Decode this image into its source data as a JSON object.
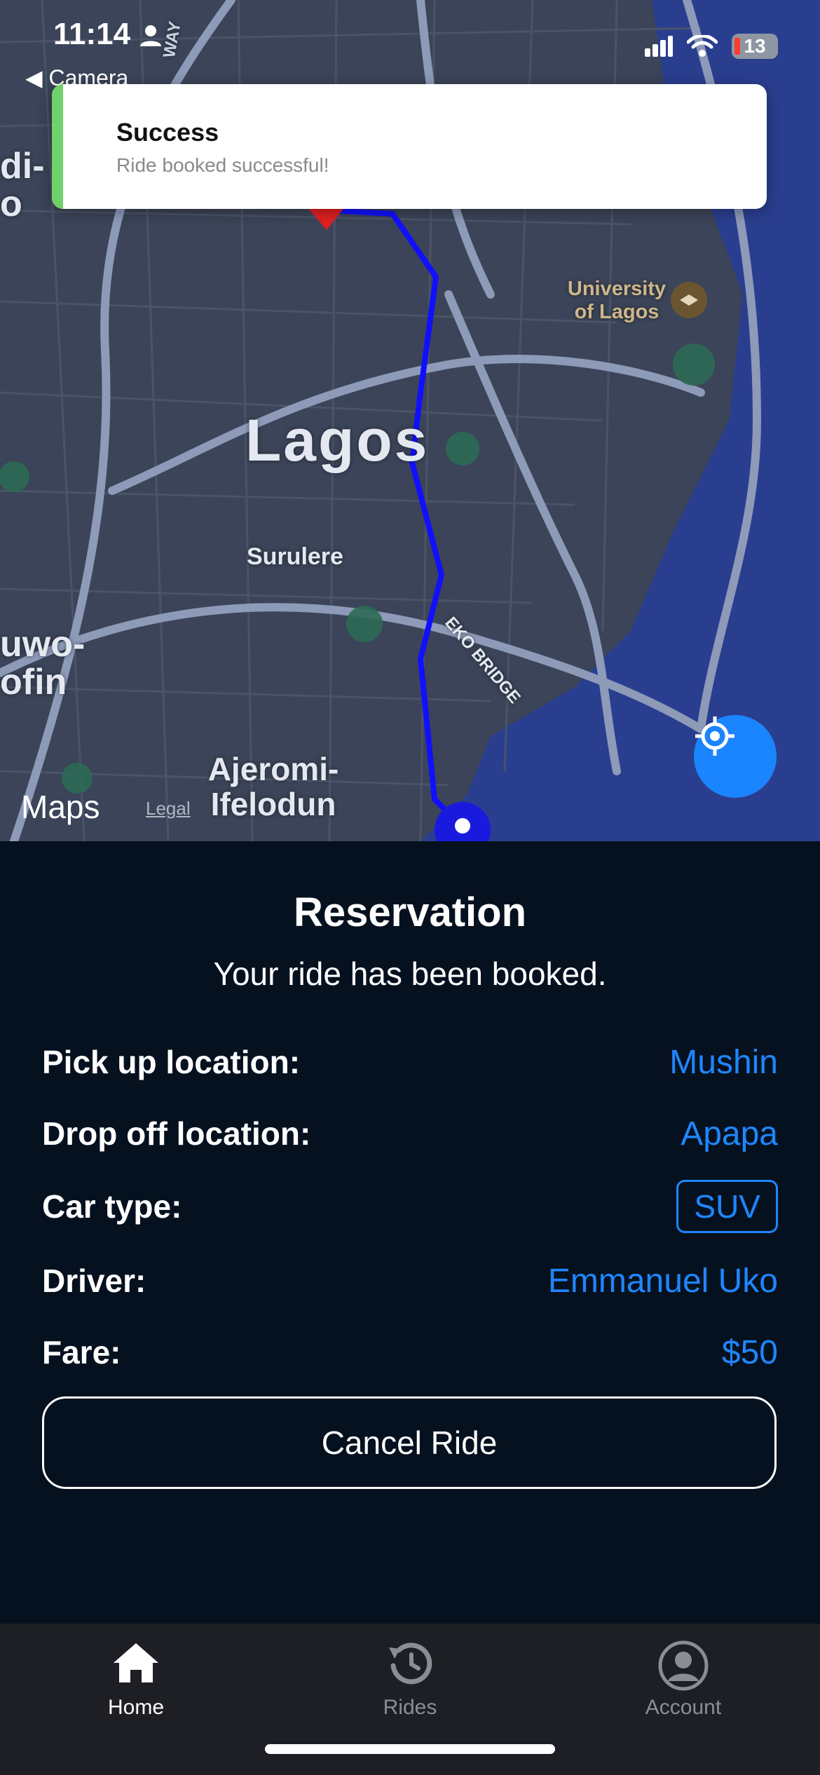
{
  "status_bar": {
    "time": "11:14",
    "back_label": "◀ Camera",
    "battery": "13"
  },
  "toast": {
    "title": "Success",
    "message": "Ride booked successful!",
    "accent": "#6fd16a"
  },
  "map": {
    "labels": {
      "city": "Lagos",
      "district_surulere": "Surulere",
      "university": "University of Lagos",
      "bridge": "EKO BRIDGE",
      "ajeromi": "Ajeromi-Ifelodun",
      "left_top": "di- o",
      "left_mid": "uwo- ofin",
      "road": "WAY"
    },
    "attribution": "Maps",
    "legal": "Legal",
    "route_color": "#1010ff"
  },
  "reservation": {
    "title": "Reservation",
    "subtitle": "Your ride has been booked.",
    "rows": [
      {
        "label": "Pick up location:",
        "value": "Mushin"
      },
      {
        "label": "Drop off location:",
        "value": "Apapa"
      },
      {
        "label": "Car type:",
        "value": "SUV"
      },
      {
        "label": "Driver:",
        "value": "Emmanuel Uko"
      },
      {
        "label": "Fare:",
        "value": "$50"
      }
    ],
    "cancel_label": "Cancel Ride",
    "accent": "#1f86ff"
  },
  "tabs": [
    {
      "label": "Home",
      "icon": "home-icon",
      "active": true
    },
    {
      "label": "Rides",
      "icon": "history-icon",
      "active": false
    },
    {
      "label": "Account",
      "icon": "account-icon",
      "active": false
    }
  ]
}
